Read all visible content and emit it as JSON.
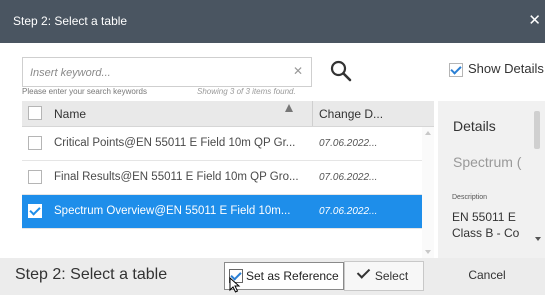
{
  "dialog": {
    "title": "Step 2: Select a table"
  },
  "search": {
    "placeholder": "Insert keyword...",
    "hint": "Please enter your search keywords",
    "showing": "Showing 3 of 3 items found."
  },
  "show_details": {
    "label": "Show Details",
    "checked": true
  },
  "table": {
    "columns": [
      "Name",
      "Change D..."
    ],
    "rows": [
      {
        "name": "Critical Points@EN 55011 E Field 10m QP Gr...",
        "date": "07.06.2022...",
        "checked": false,
        "selected": false
      },
      {
        "name": "Final Results@EN 55011 E Field 10m QP Gro...",
        "date": "07.06.2022...",
        "checked": false,
        "selected": false
      },
      {
        "name": "Spectrum Overview@EN 55011 E Field 10m...",
        "date": "07.06.2022...",
        "checked": true,
        "selected": true
      }
    ]
  },
  "details": {
    "heading": "Details",
    "selected_name": "Spectrum (",
    "description_label": "Description",
    "description_line1": "EN 55011 E",
    "description_line2": "Class B - Co"
  },
  "footer": {
    "step_label": "Step 2: Select a table",
    "set_reference_label": "Set as Reference",
    "set_reference_checked": true,
    "select_label": "Select",
    "cancel_label": "Cancel"
  },
  "icons": {
    "close": "close-icon",
    "search": "search-icon",
    "clear": "clear-icon",
    "sort": "sort-ascending-icon",
    "select_check": "check-icon",
    "cursor": "mouse-pointer-icon"
  },
  "colors": {
    "titlebar": "#4a5561",
    "selection": "#1e8eea",
    "checkmark": "#2a7fd4"
  }
}
